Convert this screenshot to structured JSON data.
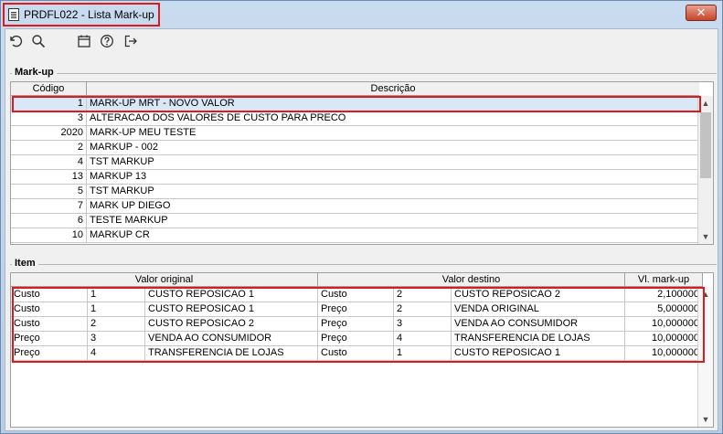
{
  "window": {
    "title": "PRDFL022 - Lista Mark-up",
    "close_symbol": "✕"
  },
  "toolbar": {
    "icons": [
      "undo-icon",
      "search-icon",
      "calendar-icon",
      "help-icon",
      "exit-icon"
    ]
  },
  "markup_group": {
    "label": "Mark-up",
    "columns": [
      "Código",
      "Descrição"
    ],
    "rows": [
      {
        "code": "1",
        "description": "MARK-UP MRT - NOVO VALOR"
      },
      {
        "code": "3",
        "description": "ALTERACAO DOS VALORES DE CUSTO PARA PRECO"
      },
      {
        "code": "2020",
        "description": "MARK-UP MEU TESTE"
      },
      {
        "code": "2",
        "description": "MARKUP - 002"
      },
      {
        "code": "4",
        "description": "TST MARKUP"
      },
      {
        "code": "13",
        "description": "MARKUP 13"
      },
      {
        "code": "5",
        "description": "TST MARKUP"
      },
      {
        "code": "7",
        "description": "MARK UP DIEGO"
      },
      {
        "code": "6",
        "description": "TESTE MARKUP"
      },
      {
        "code": "10",
        "description": "MARKUP CR"
      }
    ]
  },
  "item_group": {
    "label": "Item",
    "headers": [
      "Valor original",
      "Valor destino",
      "Vl. mark-up"
    ],
    "rows": [
      {
        "o_type": "Custo",
        "o_code": "1",
        "o_desc": "CUSTO REPOSICAO 1",
        "d_type": "Custo",
        "d_code": "2",
        "d_desc": "CUSTO REPOSICAO 2",
        "value": "2,100000"
      },
      {
        "o_type": "Custo",
        "o_code": "1",
        "o_desc": "CUSTO REPOSICAO 1",
        "d_type": "Preço",
        "d_code": "2",
        "d_desc": "VENDA ORIGINAL",
        "value": "5,000000"
      },
      {
        "o_type": "Custo",
        "o_code": "2",
        "o_desc": "CUSTO REPOSICAO 2",
        "d_type": "Preço",
        "d_code": "3",
        "d_desc": "VENDA AO CONSUMIDOR",
        "value": "10,000000"
      },
      {
        "o_type": "Preço",
        "o_code": "3",
        "o_desc": "VENDA AO CONSUMIDOR",
        "d_type": "Preço",
        "d_code": "4",
        "d_desc": "TRANSFERENCIA DE LOJAS",
        "value": "10,000000"
      },
      {
        "o_type": "Preço",
        "o_code": "4",
        "o_desc": "TRANSFERENCIA DE LOJAS",
        "d_type": "Custo",
        "d_code": "1",
        "d_desc": "CUSTO REPOSICAO 1",
        "value": "10,000000"
      }
    ]
  },
  "colors": {
    "highlight": "#e01a1a",
    "selected_row": "#d9e8f7"
  }
}
